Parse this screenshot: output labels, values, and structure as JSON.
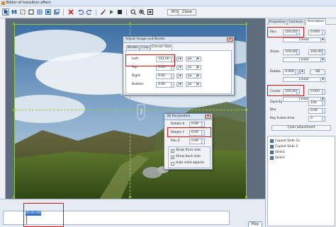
{
  "window": {
    "title": "Editor of transition effect"
  },
  "toolbar": {
    "zoom": "30%",
    "close_label": "Close",
    "icons": [
      "pointer-icon",
      "text-M-icon",
      "frame-icon",
      "crop-icon",
      "grid-icon",
      "layers-icon",
      "delete-icon",
      "undo-icon",
      "redo-icon",
      "brush-icon",
      "play-small-icon"
    ]
  },
  "adjust_dialog": {
    "title": "Adjust Image and Border",
    "tabs": [
      "Border",
      "Crop",
      "Canvas Size"
    ],
    "active_tab": "Canvas Size",
    "fields": [
      {
        "label": "Left",
        "value": "312.00",
        "unit": "px"
      },
      {
        "label": "Top",
        "value": "0.00",
        "unit": "px"
      },
      {
        "label": "Right",
        "value": "0.00",
        "unit": "px"
      },
      {
        "label": "Bottom",
        "value": "0.00",
        "unit": "px"
      }
    ]
  },
  "params_dialog": {
    "title": "3D Parameters",
    "fields": [
      {
        "label": "Rotate X",
        "value": "0.00"
      },
      {
        "label": "Rotate Y",
        "value": "0.00"
      },
      {
        "label": "Pan Z",
        "value": "0.00"
      }
    ],
    "checks": [
      {
        "label": "Show front side",
        "checked": true
      },
      {
        "label": "Show back side",
        "checked": true
      },
      {
        "label": "Hide child objects",
        "checked": false
      }
    ]
  },
  "right_panel": {
    "tabs": [
      "Properties",
      "Common",
      "Animation"
    ],
    "active_tab": "Animation",
    "pan": {
      "label": "Pan:",
      "x": "100.000",
      "y": "0.000",
      "mode": "Linear"
    },
    "zoom": {
      "label": "Zoom",
      "x": "100.000",
      "y": "100.000",
      "mode": "Linear"
    },
    "rotate": {
      "label": "Rotate",
      "value": "0.000",
      "button": "3D",
      "mode": "Linear"
    },
    "center": {
      "label": "Center",
      "x": "100.000",
      "y": "0.000",
      "mode": "Linear"
    },
    "opacity": {
      "label": "Opacity",
      "value": "100"
    },
    "blur": {
      "label": "Blur",
      "value": "0.00"
    },
    "keyframe": {
      "label": "Key frame time",
      "value": "0"
    },
    "color_button": "Color adjustment",
    "objects": [
      "Copied Slide 1a",
      "Copied Slide 1",
      "Slide2",
      "Slide1"
    ]
  },
  "timeline": {
    "time": "00:00.000",
    "play_label": "Play"
  },
  "colors": {
    "highlight": "#e01010",
    "guide": "#8ccd45",
    "accent": "#2f6fcf"
  }
}
